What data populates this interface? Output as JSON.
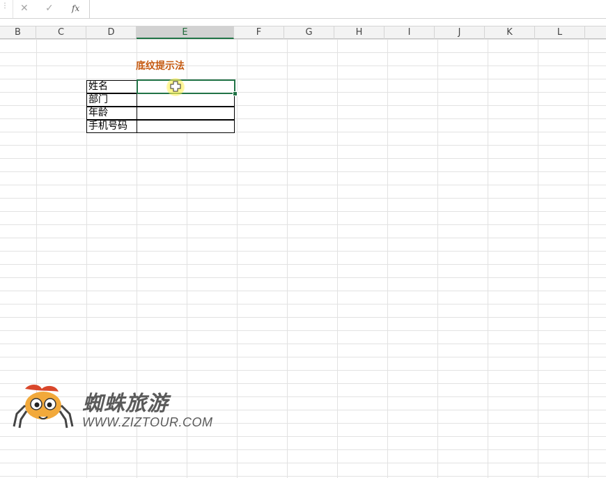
{
  "formula_bar": {
    "cancel_icon": "✕",
    "enter_icon": "✓",
    "fx_label": "fx",
    "value": ""
  },
  "columns": [
    "B",
    "C",
    "D",
    "E",
    "F",
    "G",
    "H",
    "I",
    "J",
    "K",
    "L"
  ],
  "active_column": "E",
  "sheet": {
    "title": "底纹提示法",
    "title_color": "#c55a11",
    "labels": [
      "姓名",
      "部门",
      "年龄",
      "手机号码"
    ],
    "values": [
      "",
      "",
      "",
      ""
    ]
  },
  "selection_color": "#217346",
  "watermark": {
    "brand": "蜘蛛旅游",
    "url": "WWW.ZIZTOUR.COM"
  }
}
